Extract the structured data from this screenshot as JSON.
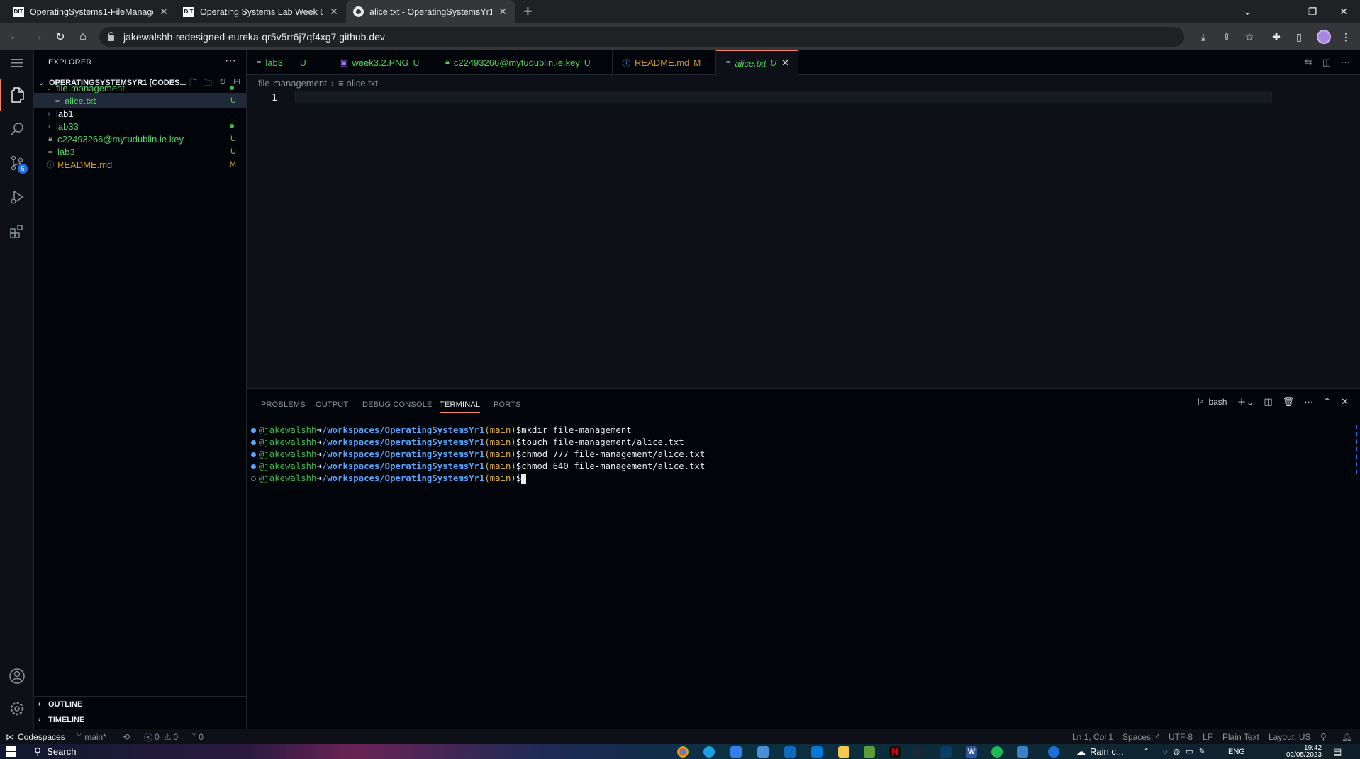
{
  "browser": {
    "tabs": [
      {
        "title": "OperatingSystems1-FileManagem",
        "favicon": "DIT"
      },
      {
        "title": "Operating Systems Lab Week 6 -",
        "favicon": "DIT"
      },
      {
        "title": "alice.txt - OperatingSystemsYr1 [",
        "favicon": "github"
      }
    ],
    "url": "jakewalshh-redesigned-eureka-qr5v5rr6j7qf4xg7.github.dev"
  },
  "explorer": {
    "title": "EXPLORER",
    "root": "OPERATINGSYSTEMSYR1 [CODES...",
    "items": [
      {
        "label": "file-management",
        "status": "",
        "kind": "folder-open"
      },
      {
        "label": "alice.txt",
        "status": "U",
        "kind": "file"
      },
      {
        "label": "lab1",
        "status": "",
        "kind": "folder"
      },
      {
        "label": "lab33",
        "status": "",
        "kind": "folder"
      },
      {
        "label": "c22493266@mytudublin.ie.key",
        "status": "U",
        "kind": "key"
      },
      {
        "label": "lab3",
        "status": "U",
        "kind": "file"
      },
      {
        "label": "README.md",
        "status": "M",
        "kind": "info"
      }
    ],
    "outline": "OUTLINE",
    "timeline": "TIMELINE"
  },
  "activity": {
    "scm_badge": "5"
  },
  "editor_tabs": [
    {
      "label": "lab3",
      "status": "U"
    },
    {
      "label": "week3.2.PNG",
      "status": "U"
    },
    {
      "label": "c22493266@mytudublin.ie.key",
      "status": "U"
    },
    {
      "label": "README.md",
      "status": "M"
    },
    {
      "label": "alice.txt",
      "status": "U"
    }
  ],
  "breadcrumb": {
    "folder": "file-management",
    "file": "alice.txt"
  },
  "editor": {
    "line": "1"
  },
  "panel": {
    "tabs": [
      "PROBLEMS",
      "OUTPUT",
      "DEBUG CONSOLE",
      "TERMINAL",
      "PORTS"
    ],
    "shell": "bash"
  },
  "terminal": {
    "user": "@jakewalshh",
    "arrow": "➜",
    "path": "/workspaces/OperatingSystemsYr1",
    "branch": "(main)",
    "prompt": "$",
    "commands": [
      "mkdir file-management",
      "touch file-management/alice.txt",
      "chmod 777 file-management/alice.txt",
      "chmod 640 file-management/alice.txt"
    ]
  },
  "status": {
    "remote": "Codespaces",
    "branch": "main*",
    "errors": "0",
    "warnings": "0",
    "ports": "0",
    "position": "Ln 1, Col 1",
    "spaces": "Spaces: 4",
    "encoding": "UTF-8",
    "eol": "LF",
    "language": "Plain Text",
    "layout": "Layout: US"
  },
  "taskbar": {
    "search": "Search",
    "weather": "Rain c...",
    "lang": "ENG",
    "time": "19:42",
    "date": "02/05/2023"
  }
}
